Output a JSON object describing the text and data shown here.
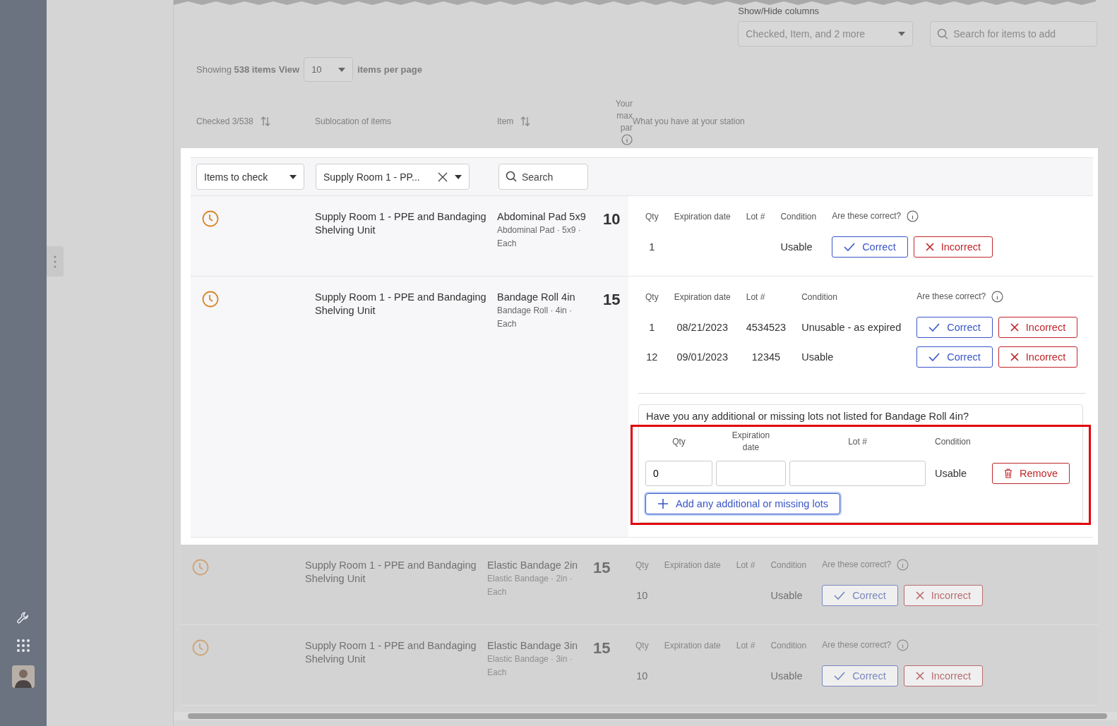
{
  "column_picker": {
    "label": "Show/Hide columns",
    "value": "Checked, Item, and 2 more"
  },
  "add_search": {
    "placeholder": "Search for items to add"
  },
  "paging": {
    "showing": "Showing **538 items**",
    "view_label": "View",
    "per_page": "10",
    "suffix": "items per page"
  },
  "columns": [
    {
      "label": "Checked 3/538",
      "sortable": true
    },
    {
      "label": "Sublocation of items",
      "sortable": false
    },
    {
      "label": "Item",
      "sortable": true
    },
    {
      "label": "Your max par",
      "sortable": false
    },
    {
      "label": "What you have at your station",
      "sortable": false
    }
  ],
  "filters": {
    "status": "Items to check",
    "sublocation": "Supply Room 1 - PP...",
    "search_placeholder": "Search"
  },
  "rows": [
    {
      "highlighted": true,
      "sublocation": "Supply Room 1 - PPE and Bandaging Shelving Unit",
      "item": "Abdominal Pad 5x9",
      "detail": "Abdominal Pad · 5x9 · Each",
      "par": "10",
      "headers": [
        "Qty",
        "Expiration date",
        "Lot #",
        "Condition",
        "Are these correct?"
      ],
      "lots": [
        {
          "qty": "1",
          "condition": "Usable",
          "correct": "Correct",
          "incorrect": "Incorrect"
        }
      ]
    },
    {
      "highlighted": true,
      "sublocation": "Supply Room 1 - PPE and Bandaging Shelving Unit",
      "item": "Bandage Roll 4in",
      "detail": "Bandage Roll · 4in · Each",
      "par": "15",
      "headers": [
        "Qty",
        "Expiration date",
        "Lot #",
        "Condition",
        "Are these correct?"
      ],
      "lots": [
        {
          "qty": "1",
          "expiration": "08/21/2023",
          "lot": "4534523",
          "condition": "Unusable - as expired",
          "correct": "Correct",
          "incorrect": "Incorrect"
        },
        {
          "qty": "12",
          "expiration": "09/01/2023",
          "lot": "12345",
          "condition": "Usable",
          "correct": "Correct",
          "incorrect": "Incorrect"
        }
      ],
      "additional": {
        "question": "Have you any additional or missing lots not listed for Bandage Roll 4in?",
        "callout": true,
        "headers": [
          "Qty",
          "Expiration date",
          "Lot #",
          "Condition"
        ],
        "entries": [
          {
            "qty": "0",
            "condition": "Usable",
            "remove": "Remove"
          }
        ],
        "add_button": "Add any additional or missing lots"
      }
    },
    {
      "highlighted": false,
      "sublocation": "Supply Room 1 - PPE and Bandaging Shelving Unit",
      "item": "Elastic Bandage 2in",
      "detail": "Elastic Bandage · 2in · Each",
      "par": "15",
      "headers": [
        "Qty",
        "Expiration date",
        "Lot #",
        "Condition",
        "Are these correct?"
      ],
      "lots": [
        {
          "qty": "10",
          "condition": "Usable",
          "correct": "Correct",
          "incorrect": "Incorrect"
        }
      ]
    },
    {
      "highlighted": false,
      "sublocation": "Supply Room 1 - PPE and Bandaging Shelving Unit",
      "item": "Elastic Bandage 3in",
      "detail": "Elastic Bandage · 3in · Each",
      "par": "15",
      "headers": [
        "Qty",
        "Expiration date",
        "Lot #",
        "Condition",
        "Are these correct?"
      ],
      "lots": [
        {
          "qty": "10",
          "condition": "Usable",
          "correct": "Correct",
          "incorrect": "Incorrect"
        }
      ]
    }
  ]
}
